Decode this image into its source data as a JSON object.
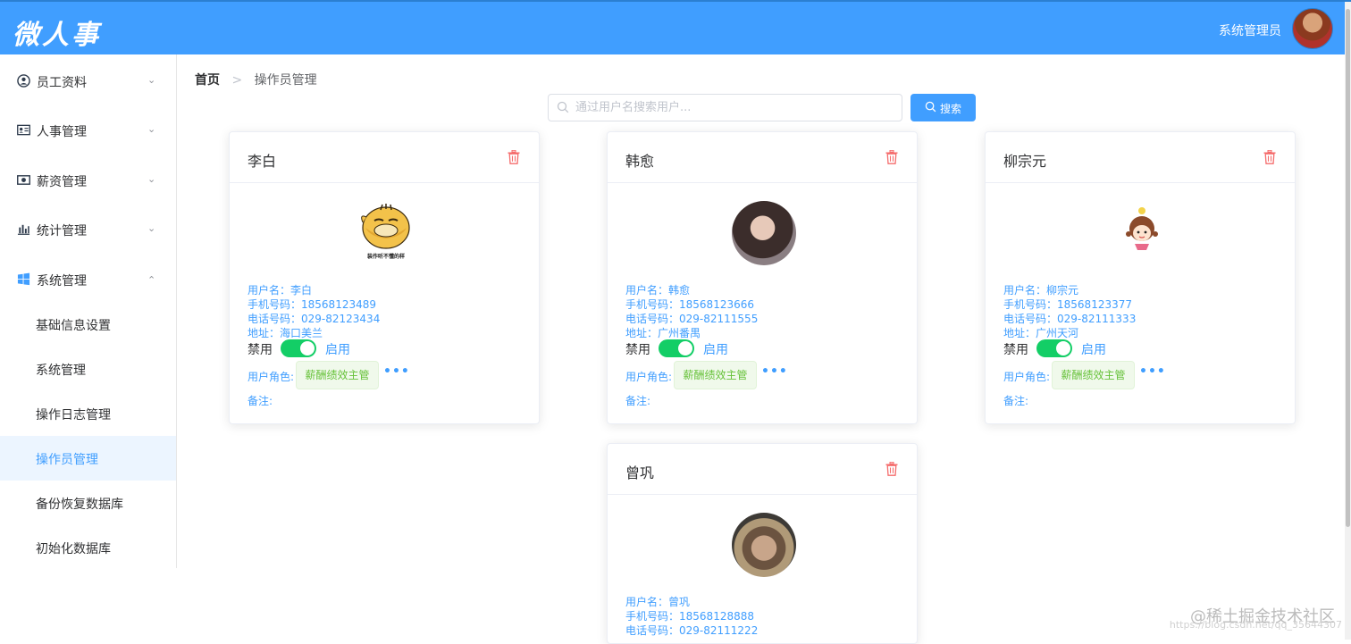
{
  "header": {
    "logo": "微人事",
    "user_name": "系统管理员"
  },
  "colors": {
    "primary": "#409eff",
    "success": "#13ce66",
    "danger": "#f56c6c",
    "tag_green": "#67c23a"
  },
  "sidebar": {
    "menus": [
      {
        "label": "员工资料",
        "icon": "user-circle-icon",
        "expanded": false
      },
      {
        "label": "人事管理",
        "icon": "id-card-icon",
        "expanded": false
      },
      {
        "label": "薪资管理",
        "icon": "money-icon",
        "expanded": false
      },
      {
        "label": "统计管理",
        "icon": "bar-chart-icon",
        "expanded": false
      },
      {
        "label": "系统管理",
        "icon": "windows-icon",
        "expanded": true
      }
    ],
    "submenu": [
      {
        "label": "基础信息设置",
        "active": false
      },
      {
        "label": "系统管理",
        "active": false
      },
      {
        "label": "操作日志管理",
        "active": false
      },
      {
        "label": "操作员管理",
        "active": true
      },
      {
        "label": "备份恢复数据库",
        "active": false
      },
      {
        "label": "初始化数据库",
        "active": false
      }
    ]
  },
  "breadcrumb": {
    "home": "首页",
    "separator": ">",
    "current": "操作员管理"
  },
  "search": {
    "placeholder": "通过用户名搜索用户...",
    "value": "",
    "button_label": "搜索"
  },
  "labels": {
    "username": "用户名：",
    "phone": "手机号码：",
    "telephone": "电话号码：",
    "address": "地址：",
    "disabled": "禁用",
    "enabled": "启用",
    "role": "用户角色:",
    "remark": "备注:",
    "more": "•••"
  },
  "cards": [
    {
      "name": "李白",
      "username": "李白",
      "phone": "18568123489",
      "telephone": "029-82123434",
      "address": "海口美兰",
      "enabled": true,
      "role": "薪酬绩效主管",
      "remark": "",
      "avatar_caption": "装作听不懂的样"
    },
    {
      "name": "韩愈",
      "username": "韩愈",
      "phone": "18568123666",
      "telephone": "029-82111555",
      "address": "广州番禺",
      "enabled": true,
      "role": "薪酬绩效主管",
      "remark": ""
    },
    {
      "name": "柳宗元",
      "username": "柳宗元",
      "phone": "18568123377",
      "telephone": "029-82111333",
      "address": "广州天河",
      "enabled": true,
      "role": "薪酬绩效主管",
      "remark": ""
    },
    {
      "name": "曾巩",
      "username": "曾巩",
      "phone": "18568128888",
      "telephone": "029-82111222",
      "address": "",
      "enabled": true,
      "role": "",
      "remark": ""
    }
  ],
  "watermark": {
    "text": "@稀土掘金技术社区",
    "url": "https://blog.csdn.net/qq_35644307"
  }
}
